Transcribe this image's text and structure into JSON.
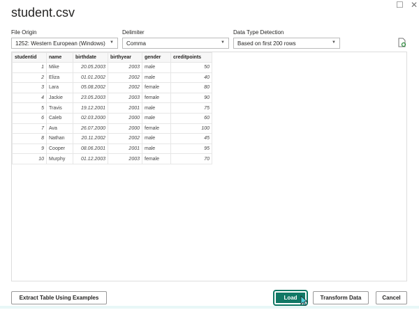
{
  "dialog": {
    "title": "student.csv"
  },
  "options": {
    "file_origin": {
      "label": "File Origin",
      "value": "1252: Western European (Windows)"
    },
    "delimiter": {
      "label": "Delimiter",
      "value": "Comma"
    },
    "detection": {
      "label": "Data Type Detection",
      "value": "Based on first 200 rows"
    }
  },
  "table": {
    "columns": [
      "studentid",
      "name",
      "birthdate",
      "birthyear",
      "gender",
      "creditpoints"
    ],
    "rows": [
      [
        "1",
        "Mike",
        "20.05.2003",
        "2003",
        "male",
        "50"
      ],
      [
        "2",
        "Eliza",
        "01.01.2002",
        "2002",
        "male",
        "40"
      ],
      [
        "3",
        "Lara",
        "05.08.2002",
        "2002",
        "female",
        "80"
      ],
      [
        "4",
        "Jackie",
        "23.05.2003",
        "2003",
        "female",
        "90"
      ],
      [
        "5",
        "Travis",
        "19.12.2001",
        "2001",
        "male",
        "75"
      ],
      [
        "6",
        "Caleb",
        "02.03.2000",
        "2000",
        "male",
        "60"
      ],
      [
        "7",
        "Ava",
        "26.07.2000",
        "2000",
        "female",
        "100"
      ],
      [
        "8",
        "Nathan",
        "20.11.2002",
        "2002",
        "male",
        "45"
      ],
      [
        "9",
        "Cooper",
        "08.06.2001",
        "2001",
        "male",
        "95"
      ],
      [
        "10",
        "Murphy",
        "01.12.2003",
        "2003",
        "female",
        "70"
      ]
    ]
  },
  "buttons": {
    "extract": "Extract Table Using Examples",
    "load": "Load",
    "transform": "Transform Data",
    "cancel": "Cancel"
  },
  "colors": {
    "accent": "#117865"
  }
}
